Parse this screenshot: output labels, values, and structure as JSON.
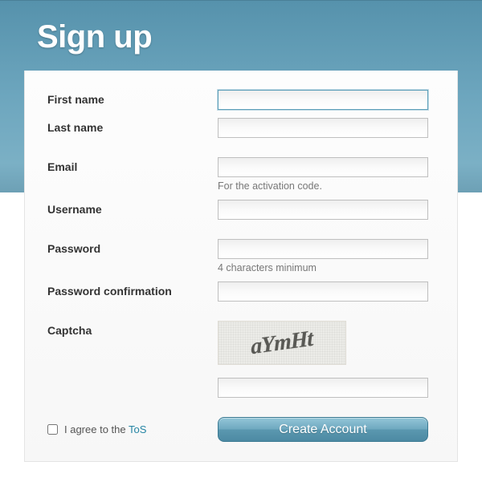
{
  "page": {
    "title": "Sign up"
  },
  "form": {
    "first_name": {
      "label": "First name",
      "value": ""
    },
    "last_name": {
      "label": "Last name",
      "value": ""
    },
    "email": {
      "label": "Email",
      "value": "",
      "hint": "For the activation code."
    },
    "username": {
      "label": "Username",
      "value": ""
    },
    "password": {
      "label": "Password",
      "value": "",
      "hint": "4 characters minimum"
    },
    "password_confirmation": {
      "label": "Password confirmation",
      "value": ""
    },
    "captcha": {
      "label": "Captcha",
      "challenge": "aYmHt",
      "value": ""
    },
    "agree": {
      "prefix": "I agree to the ",
      "tos_label": "ToS",
      "checked": false
    },
    "submit_label": "Create Account"
  }
}
